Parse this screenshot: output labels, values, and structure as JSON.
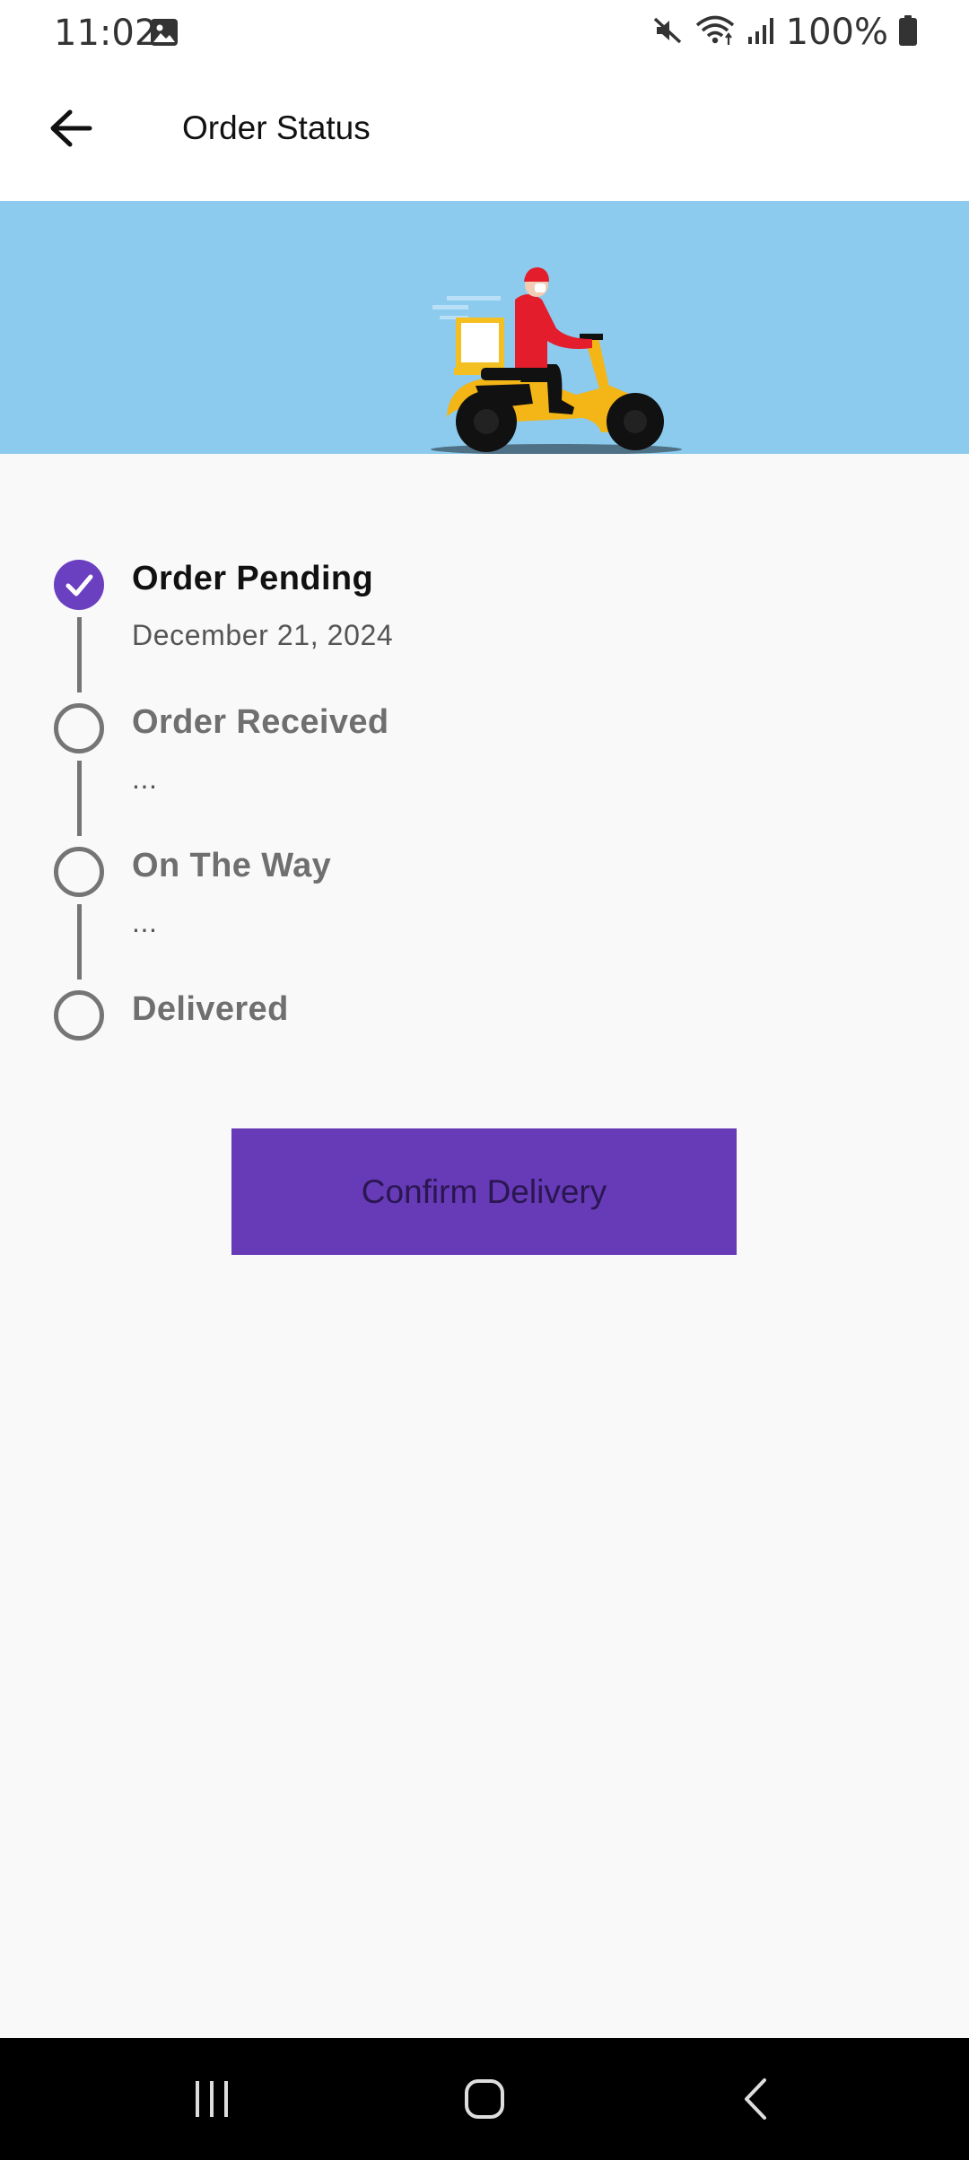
{
  "status_bar": {
    "time": "11:02",
    "battery": "100%",
    "icons": [
      "image-icon",
      "mute-icon",
      "wifi-icon",
      "signal-icon",
      "battery-icon"
    ]
  },
  "app_bar": {
    "title": "Order Status",
    "back_icon": "arrow-left-icon"
  },
  "hero": {
    "illustration": "delivery-scooter-illustration",
    "background_color": "#8ccbee"
  },
  "timeline": {
    "steps": [
      {
        "title": "Order Pending",
        "subtitle": "December 21, 2024",
        "completed": true
      },
      {
        "title": "Order Received",
        "subtitle": "...",
        "completed": false
      },
      {
        "title": "On The Way",
        "subtitle": "...",
        "completed": false
      },
      {
        "title": "Delivered",
        "subtitle": "",
        "completed": false
      }
    ]
  },
  "actions": {
    "confirm_label": "Confirm Delivery",
    "confirm_color": "#673ab7"
  },
  "nav_bar": {
    "buttons": [
      "recents-icon",
      "home-icon",
      "back-icon"
    ]
  },
  "colors": {
    "accent": "#673ab7",
    "completed": "#6a3fc0",
    "pending": "#757575"
  }
}
